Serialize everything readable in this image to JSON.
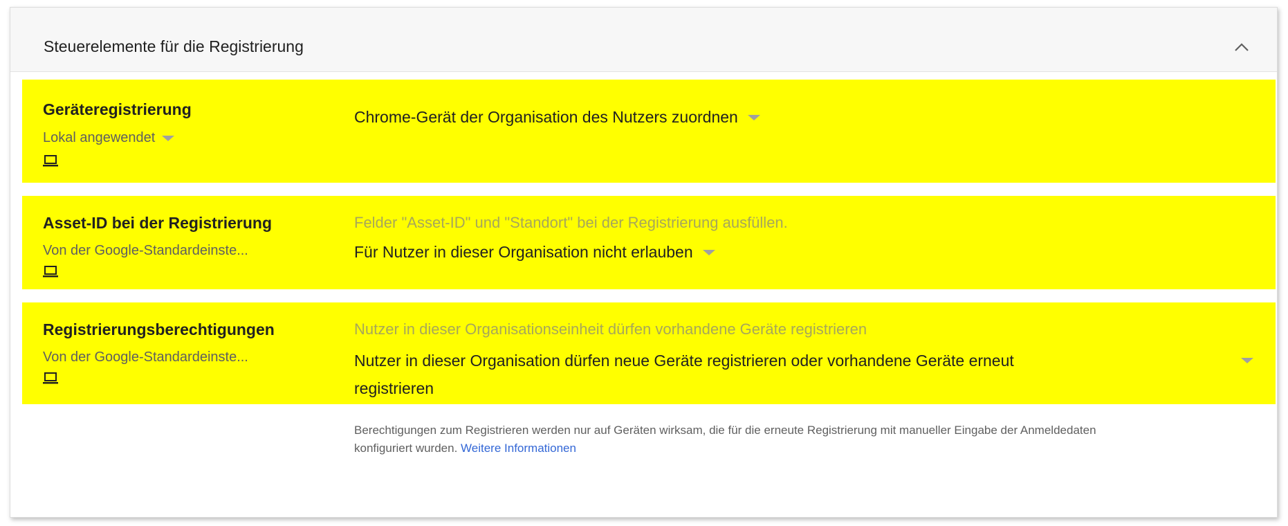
{
  "card": {
    "title": "Steuerelemente für die Registrierung",
    "collapse_icon": "chevron-up-icon"
  },
  "settings": [
    {
      "label": "Geräteregistrierung",
      "source": "Lokal angewendet",
      "device_icon": "laptop-icon",
      "hint": "",
      "value": "Chrome-Gerät der Organisation des Nutzers zuordnen"
    },
    {
      "label": "Asset-ID bei der Registrierung",
      "source": "Von der Google-Standardeinste...",
      "device_icon": "laptop-icon",
      "hint": "Felder \"Asset-ID\" und \"Standort\" bei der Registrierung ausfüllen.",
      "value": "Für Nutzer in dieser Organisation nicht erlauben"
    },
    {
      "label": "Registrierungsberechtigungen",
      "source": "Von der Google-Standardeinste...",
      "device_icon": "laptop-icon",
      "hint": "Nutzer in dieser Organisationseinheit dürfen vorhandene Geräte registrieren",
      "value_line1": "Nutzer in dieser Organisation dürfen neue Geräte registrieren oder vorhandene Geräte erneut",
      "value_line2": "registrieren"
    }
  ],
  "info": {
    "text": "Berechtigungen zum Registrieren werden nur auf Geräten wirksam, die für die erneute Registrierung mit manueller Eingabe der Anmeldedaten konfiguriert wurden. ",
    "link": "Weitere Informationen"
  },
  "colors": {
    "highlight": "#ffff00",
    "link": "#3367d6",
    "header_bg": "#f7f7f7"
  }
}
